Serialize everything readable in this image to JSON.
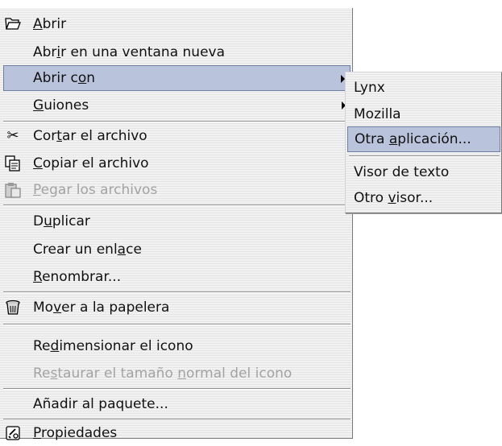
{
  "main_menu": {
    "open": {
      "pre": "",
      "mnemonic": "A",
      "post": "brir",
      "icon": "folder-open-icon"
    },
    "open_new_window": {
      "pre": "Abr",
      "mnemonic": "i",
      "post": "r en una ventana nueva"
    },
    "open_with": {
      "pre": "Abrir c",
      "mnemonic": "o",
      "post": "n"
    },
    "scripts": {
      "pre": "",
      "mnemonic": "G",
      "post": "uiones"
    },
    "cut": {
      "pre": "Cor",
      "mnemonic": "t",
      "post": "ar el archivo",
      "icon": "scissors-icon"
    },
    "copy": {
      "pre": "",
      "mnemonic": "C",
      "post": "opiar el archivo",
      "icon": "copy-icon"
    },
    "paste": {
      "pre": "",
      "mnemonic": "P",
      "post": "egar los archivos",
      "icon": "clipboard-icon"
    },
    "duplicate": {
      "pre": "D",
      "mnemonic": "u",
      "post": "plicar"
    },
    "make_link": {
      "pre": "Crear un enl",
      "mnemonic": "a",
      "post": "ce"
    },
    "rename": {
      "pre": "",
      "mnemonic": "R",
      "post": "enombrar..."
    },
    "trash": {
      "pre": "Mo",
      "mnemonic": "v",
      "post": "er a la papelera",
      "icon": "trash-icon"
    },
    "resize_icon": {
      "pre": "Re",
      "mnemonic": "d",
      "post": "imensionar el icono"
    },
    "restore_icon": {
      "pre": "Re",
      "mnemonic": "s",
      "mid": "taurar el tamaño ",
      "mnemonic2": "n",
      "post": "ormal del icono"
    },
    "add_package": {
      "pre": "Añadir al paquete...",
      "mnemonic": "",
      "post": ""
    },
    "properties": {
      "pre": "",
      "mnemonic": "P",
      "post": "ropiedades",
      "icon": "properties-icon"
    }
  },
  "open_with_submenu": {
    "lynx": "Lynx",
    "mozilla": "Mozilla",
    "other_app": {
      "pre": "Otra ",
      "mnemonic": "a",
      "post": "plicación..."
    },
    "text_viewer": "Visor de texto",
    "other_viewer": {
      "pre": "Otro ",
      "mnemonic": "v",
      "post": "isor..."
    }
  },
  "colors": {
    "highlight": "#b9c4dc",
    "highlight_border": "#6f7fa2",
    "disabled_text": "#a3a3a3",
    "menu_background": "#ececec"
  }
}
